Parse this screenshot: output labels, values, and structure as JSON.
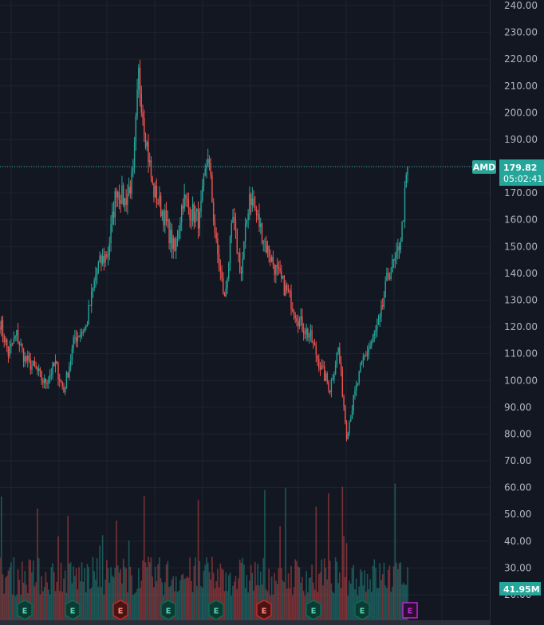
{
  "chart_data": {
    "type": "candlestick",
    "symbol": "AMD",
    "last_price": "179.82",
    "countdown": "05:02:41",
    "volume_label": "41.95M",
    "ylim": [
      15,
      242
    ],
    "y_ticks": [
      "20.00",
      "30.00",
      "40.00",
      "50.00",
      "60.00",
      "70.00",
      "80.00",
      "90.00",
      "100.00",
      "110.00",
      "120.00",
      "130.00",
      "140.00",
      "150.00",
      "160.00",
      "170.00",
      "180.00",
      "190.00",
      "200.00",
      "210.00",
      "220.00",
      "230.00",
      "240.00"
    ],
    "price_path_keypoints": [
      {
        "bar": 0,
        "close": 122
      },
      {
        "bar": 6,
        "close": 110
      },
      {
        "bar": 12,
        "close": 117
      },
      {
        "bar": 18,
        "close": 108
      },
      {
        "bar": 26,
        "close": 104
      },
      {
        "bar": 32,
        "close": 99
      },
      {
        "bar": 40,
        "close": 106
      },
      {
        "bar": 46,
        "close": 96
      },
      {
        "bar": 54,
        "close": 116
      },
      {
        "bar": 62,
        "close": 120
      },
      {
        "bar": 70,
        "close": 142
      },
      {
        "bar": 78,
        "close": 148
      },
      {
        "bar": 84,
        "close": 172
      },
      {
        "bar": 90,
        "close": 167
      },
      {
        "bar": 96,
        "close": 176
      },
      {
        "bar": 100,
        "close": 214
      },
      {
        "bar": 104,
        "close": 196
      },
      {
        "bar": 110,
        "close": 172
      },
      {
        "bar": 118,
        "close": 162
      },
      {
        "bar": 126,
        "close": 148
      },
      {
        "bar": 132,
        "close": 168
      },
      {
        "bar": 138,
        "close": 163
      },
      {
        "bar": 144,
        "close": 160
      },
      {
        "bar": 150,
        "close": 185
      },
      {
        "bar": 156,
        "close": 150
      },
      {
        "bar": 162,
        "close": 130
      },
      {
        "bar": 168,
        "close": 160
      },
      {
        "bar": 174,
        "close": 140
      },
      {
        "bar": 180,
        "close": 170
      },
      {
        "bar": 186,
        "close": 160
      },
      {
        "bar": 192,
        "close": 150
      },
      {
        "bar": 200,
        "close": 140
      },
      {
        "bar": 208,
        "close": 132
      },
      {
        "bar": 216,
        "close": 122
      },
      {
        "bar": 224,
        "close": 116
      },
      {
        "bar": 232,
        "close": 104
      },
      {
        "bar": 238,
        "close": 97
      },
      {
        "bar": 244,
        "close": 112
      },
      {
        "bar": 250,
        "close": 80
      },
      {
        "bar": 256,
        "close": 95
      },
      {
        "bar": 262,
        "close": 108
      },
      {
        "bar": 268,
        "close": 114
      },
      {
        "bar": 274,
        "close": 122
      },
      {
        "bar": 280,
        "close": 140
      },
      {
        "bar": 286,
        "close": 145
      },
      {
        "bar": 290,
        "close": 157
      },
      {
        "bar": 294,
        "close": 180
      }
    ],
    "earnings_markers": [
      {
        "label": "E",
        "status": "positive"
      },
      {
        "label": "E",
        "status": "positive"
      },
      {
        "label": "E",
        "status": "negative"
      },
      {
        "label": "E",
        "status": "positive"
      },
      {
        "label": "E",
        "status": "positive"
      },
      {
        "label": "E",
        "status": "negative"
      },
      {
        "label": "E",
        "status": "positive"
      },
      {
        "label": "E",
        "status": "positive"
      },
      {
        "label": "E",
        "status": "upcoming"
      }
    ],
    "colors": {
      "background": "#131722",
      "grid": "#1f2330",
      "up": "#26a69a",
      "down": "#ef5350",
      "price_line": "#26a69a",
      "axis_text": "#b2b5be",
      "upcoming": "#c026d3"
    }
  }
}
